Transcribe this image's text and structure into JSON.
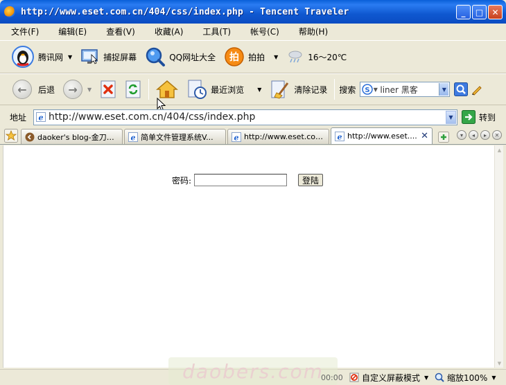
{
  "window": {
    "title": "http://www.eset.com.cn/404/css/index.php - Tencent Traveler",
    "controls": [
      "_",
      "□",
      "✕"
    ]
  },
  "menu": [
    "文件(F)",
    "编辑(E)",
    "查看(V)",
    "收藏(A)",
    "工具(T)",
    "帐号(C)",
    "帮助(H)"
  ],
  "toolbar1": {
    "tencent": "腾讯网",
    "capture": "捕捉屏幕",
    "qq_sites": "QQ网址大全",
    "paipai": "拍拍",
    "weather": "16～20℃"
  },
  "toolbar2": {
    "back": "后退",
    "recent": "最近浏览",
    "clear": "清除记录",
    "search_label": "搜索",
    "search_value": "liner 黑客"
  },
  "address": {
    "label": "地址",
    "url": "http://www.eset.com.cn/404/css/index.php",
    "go": "转到"
  },
  "tabs": [
    {
      "title": "daoker's blog-金刀客..."
    },
    {
      "title": "简单文件管理系统V..."
    },
    {
      "title": "http://www.eset.com..."
    },
    {
      "title": "http://www.eset...."
    }
  ],
  "page": {
    "password_label": "密码:",
    "password_value": "",
    "login_button": "登陆"
  },
  "status": {
    "watermark": "daobers.com",
    "time": "00:00",
    "filter_mode": "自定义屏蔽模式",
    "zoom": "缩放100%"
  },
  "colors": {
    "titlebar": "#0b58d2",
    "chrome": "#ece9d8",
    "content": "#ffffff"
  }
}
